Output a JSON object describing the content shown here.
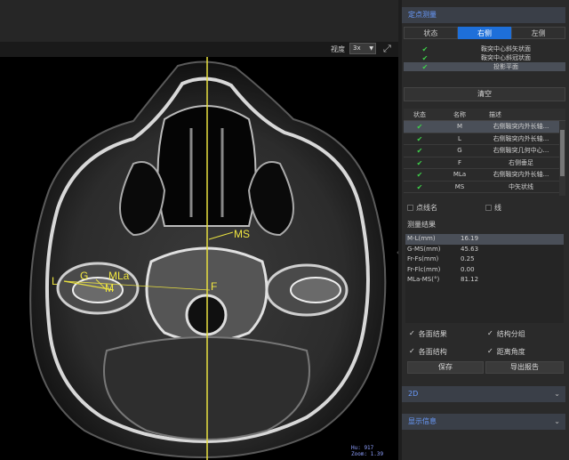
{
  "viewer": {
    "zoom_label": "视度",
    "zoom_value": "3x",
    "labels": {
      "ms": "MS",
      "l": "L",
      "g": "G",
      "mla": "MLa",
      "m": "M",
      "f": "F"
    },
    "hu_line": "Hu: 917",
    "zoom_line": "Zoom: 1.39",
    "colors": {
      "annotation": "#f0e640",
      "readout": "#8fa0ff"
    }
  },
  "panel": {
    "section1_title": "定点测量",
    "tabs": [
      "状态",
      "右侧",
      "左侧"
    ],
    "active_tab": "右侧",
    "visibility_list": [
      {
        "checked": true,
        "label": "鞍突中心斜矢状面"
      },
      {
        "checked": true,
        "label": "鞍突中心斜冠状面"
      },
      {
        "checked": true,
        "label": "投影平面"
      }
    ],
    "clear_label": "清空",
    "table_headers": [
      "状态",
      "名称",
      "描述"
    ],
    "table_rows": [
      {
        "name": "M",
        "desc": "右侧鞍突内外长轴..."
      },
      {
        "name": "L",
        "desc": "右侧鞍突内外长轴..."
      },
      {
        "name": "G",
        "desc": "右侧鞍突几何中心..."
      },
      {
        "name": "F",
        "desc": "右侧垂足"
      },
      {
        "name": "MLa",
        "desc": "右侧鞍突内外长轴..."
      },
      {
        "name": "MS",
        "desc": "中矢状线"
      }
    ],
    "option_point_name": "点线名",
    "option_line": "线",
    "results_title": "测量结果",
    "results": [
      {
        "k": "M-L(mm)",
        "v": "16.19"
      },
      {
        "k": "G-MS(mm)",
        "v": "45.63"
      },
      {
        "k": "Fr-Fs(mm)",
        "v": "0.25"
      },
      {
        "k": "Fr-Flc(mm)",
        "v": "0.00"
      },
      {
        "k": "MLa-MS(°)",
        "v": "81.12"
      }
    ],
    "check_all_results": "各面结果",
    "check_structure_group": "结构分组",
    "check_all_structures": "各面结构",
    "check_distance_angle": "距离角度",
    "save_label": "保存",
    "export_label": "导出报告",
    "section2_title": "2D",
    "section3_title": "显示信息",
    "colors": {
      "accent": "#1e6fd9",
      "check": "#3ed04a",
      "section_text": "#6a9cff"
    }
  }
}
